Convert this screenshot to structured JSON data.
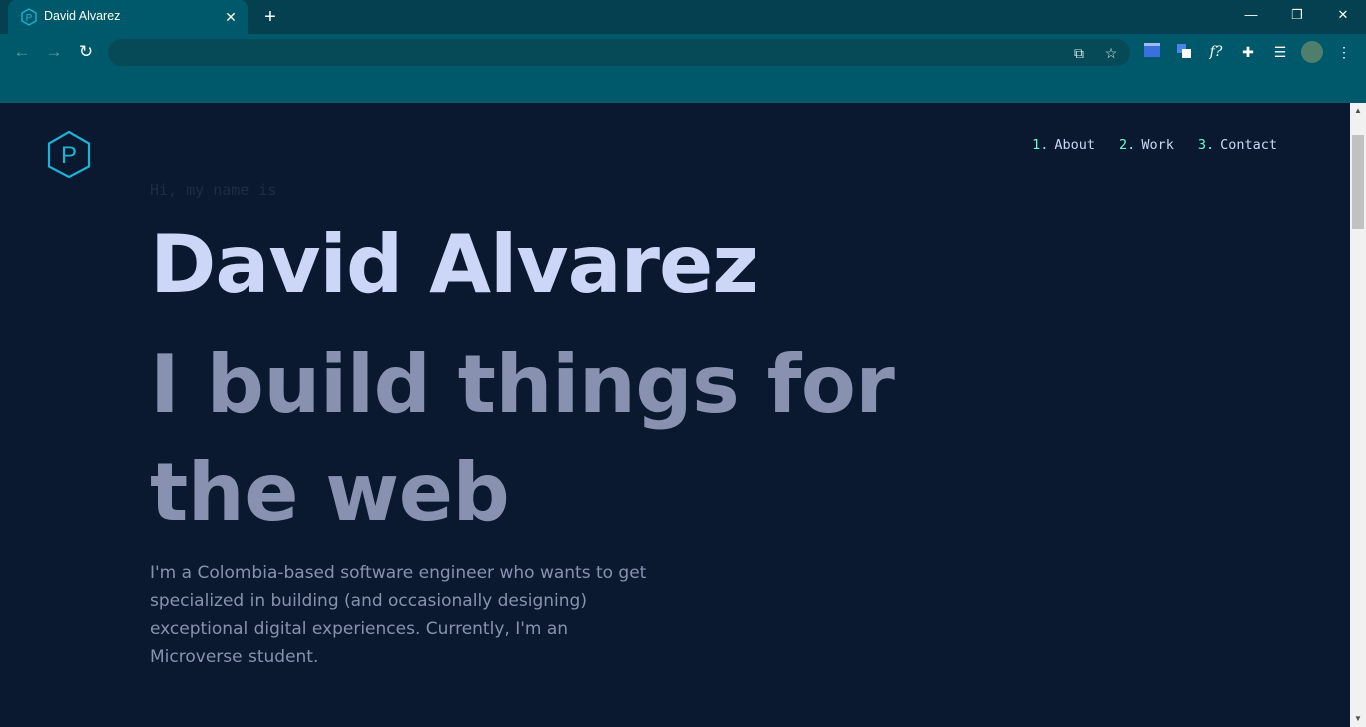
{
  "browser": {
    "tab_title": "David Alvarez",
    "window_controls": {
      "minimize": "—",
      "restore": "❐",
      "close": "✕"
    }
  },
  "page": {
    "nav": [
      {
        "num": "1.",
        "label": "About"
      },
      {
        "num": "2.",
        "label": "Work"
      },
      {
        "num": "3.",
        "label": "Contact"
      }
    ],
    "logo_letter": "P",
    "intro": "Hi, my name is",
    "name": "David Alvarez",
    "tagline": "I build things for the web",
    "bio": "I'm a Colombia-based software engineer who wants to get specialized in building (and occasionally designing) exceptional digital experiences. Currently, I'm an Microverse student."
  },
  "colors": {
    "background": "#0a192f",
    "accent": "#64ffda",
    "heading": "#ccd6f6",
    "muted": "#8892b0",
    "logo": "#1bb3d6",
    "chrome": "#00596a"
  }
}
